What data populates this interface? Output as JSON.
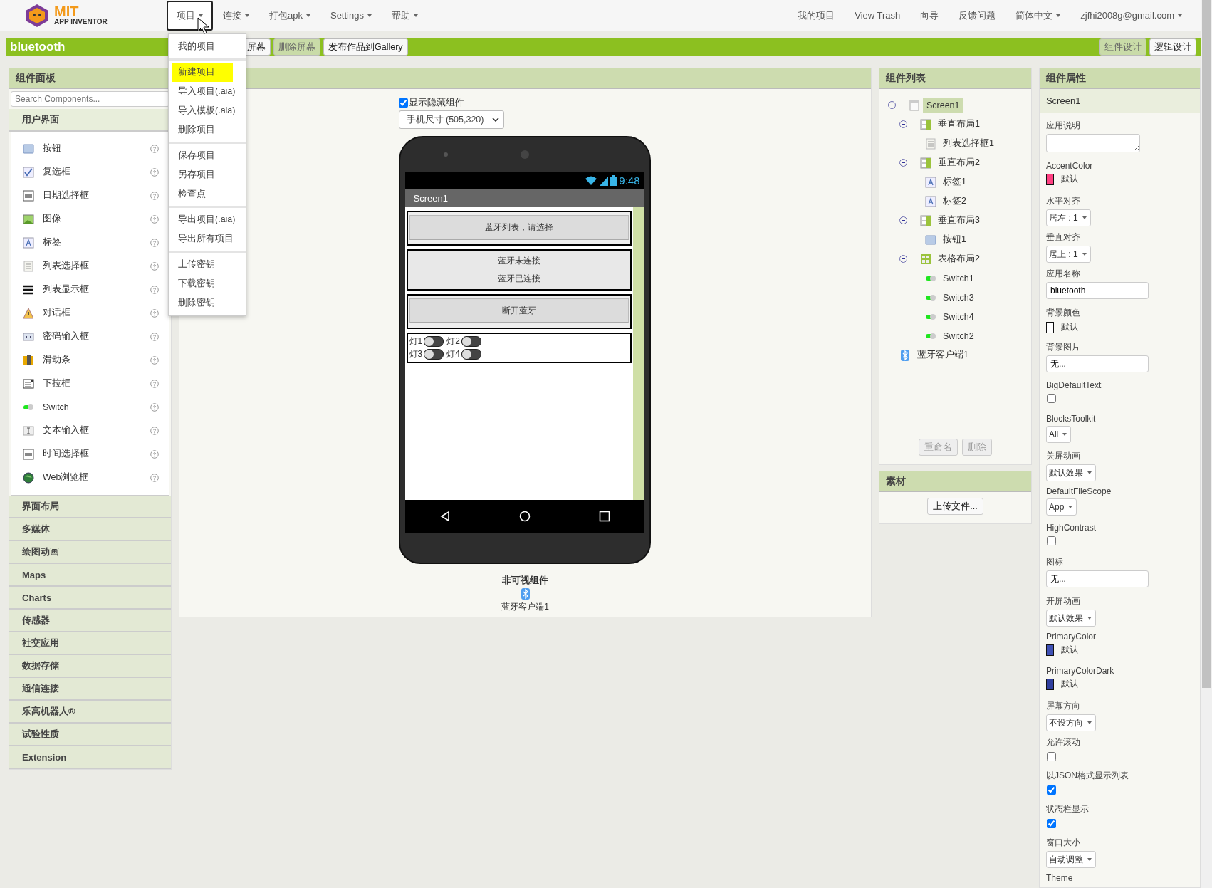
{
  "logo": {
    "title": "MIT",
    "subtitle": "APP INVENTOR"
  },
  "nav": {
    "left": [
      {
        "label": "项目",
        "selected": true
      },
      {
        "label": "连接",
        "selected": false
      },
      {
        "label": "打包apk",
        "selected": false
      },
      {
        "label": "Settings",
        "selected": false
      },
      {
        "label": "帮助",
        "selected": false
      }
    ],
    "right": [
      {
        "label": "我的项目",
        "dropdown": false
      },
      {
        "label": "View Trash",
        "dropdown": false
      },
      {
        "label": "向导",
        "dropdown": false
      },
      {
        "label": "反馈问题",
        "dropdown": false
      },
      {
        "label": "简体中文",
        "dropdown": true
      },
      {
        "label": "zjfhi2008g@gmail.com",
        "dropdown": true
      }
    ]
  },
  "project_menu": [
    [
      {
        "label": "我的项目",
        "selected": false
      }
    ],
    [
      {
        "label": "新建项目",
        "selected": true
      },
      {
        "label": "导入项目(.aia)",
        "selected": false
      },
      {
        "label": "导入模板(.aia)",
        "selected": false
      },
      {
        "label": "删除项目",
        "selected": false
      }
    ],
    [
      {
        "label": "保存项目",
        "selected": false
      },
      {
        "label": "另存项目",
        "selected": false
      },
      {
        "label": "检查点",
        "selected": false
      }
    ],
    [
      {
        "label": "导出项目(.aia)",
        "selected": false
      },
      {
        "label": "导出所有项目",
        "selected": false
      }
    ],
    [
      {
        "label": "上传密钥",
        "selected": false
      },
      {
        "label": "下载密钥",
        "selected": false
      },
      {
        "label": "删除密钥",
        "selected": false
      }
    ]
  ],
  "toolbar": {
    "project_name": "bluetooth",
    "buttons": [
      {
        "label": "屏幕",
        "disabled": false
      },
      {
        "label": "删除屏幕",
        "disabled": true
      },
      {
        "label": "发布作品到Gallery",
        "disabled": false
      }
    ],
    "views": [
      {
        "label": "组件设计",
        "selected": true
      },
      {
        "label": "逻辑设计",
        "selected": false
      }
    ]
  },
  "palette": {
    "title": "组件面板",
    "search": {
      "placeholder": "Search Components..."
    },
    "open_category": "用户界面",
    "items": [
      {
        "kind": "button",
        "label": "按钮"
      },
      {
        "kind": "checkbox",
        "label": "复选框"
      },
      {
        "kind": "datepicker",
        "label": "日期选择框"
      },
      {
        "kind": "image",
        "label": "图像"
      },
      {
        "kind": "label",
        "label": "标签"
      },
      {
        "kind": "listpicker",
        "label": "列表选择框"
      },
      {
        "kind": "listview",
        "label": "列表显示框"
      },
      {
        "kind": "notifier",
        "label": "对话框"
      },
      {
        "kind": "password",
        "label": "密码输入框"
      },
      {
        "kind": "slider",
        "label": "滑动条"
      },
      {
        "kind": "spinner",
        "label": "下拉框"
      },
      {
        "kind": "switch",
        "label": "Switch"
      },
      {
        "kind": "textbox",
        "label": "文本输入框"
      },
      {
        "kind": "timepicker",
        "label": "时间选择框"
      },
      {
        "kind": "webviewer",
        "label": "Web浏览框"
      }
    ],
    "categories": [
      "界面布局",
      "多媒体",
      "绘图动画",
      "Maps",
      "Charts",
      "传感器",
      "社交应用",
      "数据存储",
      "通信连接",
      "乐高机器人®",
      "试验性质",
      "Extension"
    ]
  },
  "viewer": {
    "show_hidden": {
      "label": "显示隐藏组件",
      "checked": true
    },
    "size": "手机尺寸 (505,320)",
    "phone": {
      "time": "9:48",
      "title": "Screen1",
      "blocks": [
        {
          "kind": "listpicker",
          "text": "蓝牙列表，请选择"
        },
        {
          "kind": "labels",
          "texts": [
            "蓝牙未连接",
            "蓝牙已连接"
          ]
        },
        {
          "kind": "button",
          "text": "断开蓝牙"
        },
        {
          "kind": "switches",
          "rows": [
            [
              {
                "label": "灯1",
                "on": false
              },
              {
                "label": "灯2",
                "on": false
              }
            ],
            [
              {
                "label": "灯3",
                "on": false
              },
              {
                "label": "灯4",
                "on": false
              }
            ]
          ]
        }
      ]
    },
    "nonvisible_title": "非可视组件",
    "nonvisible": [
      {
        "kind": "bluetooth",
        "name": "蓝牙客户端1"
      }
    ]
  },
  "tree": {
    "title": "组件列表",
    "nodes": [
      {
        "kind": "screen",
        "name": "Screen1",
        "selected": true,
        "expanded": true,
        "children": [
          {
            "kind": "vertical",
            "name": "垂直布局1",
            "selected": false,
            "expanded": true,
            "children": [
              {
                "kind": "listpicker",
                "name": "列表选择框1",
                "selected": false
              }
            ]
          },
          {
            "kind": "vertical",
            "name": "垂直布局2",
            "selected": false,
            "expanded": true,
            "children": [
              {
                "kind": "label",
                "name": "标签1",
                "selected": false
              },
              {
                "kind": "label",
                "name": "标签2",
                "selected": false
              }
            ]
          },
          {
            "kind": "vertical",
            "name": "垂直布局3",
            "selected": false,
            "expanded": true,
            "children": [
              {
                "kind": "button",
                "name": "按钮1",
                "selected": false
              }
            ]
          },
          {
            "kind": "table",
            "name": "表格布局2",
            "selected": false,
            "expanded": true,
            "children": [
              {
                "kind": "switch",
                "name": "Switch1",
                "selected": false
              },
              {
                "kind": "switch",
                "name": "Switch3",
                "selected": false
              },
              {
                "kind": "switch",
                "name": "Switch4",
                "selected": false
              },
              {
                "kind": "switch",
                "name": "Switch2",
                "selected": false
              }
            ]
          },
          {
            "kind": "bluetooth",
            "name": "蓝牙客户端1",
            "selected": false
          }
        ]
      }
    ],
    "buttons": [
      {
        "label": "重命名",
        "disabled": true
      },
      {
        "label": "删除",
        "disabled": true
      }
    ]
  },
  "media": {
    "title": "素材",
    "upload": "上传文件..."
  },
  "properties": {
    "title": "组件属性",
    "component": "Screen1",
    "items": [
      {
        "kind": "textarea",
        "label": "应用说明"
      },
      {
        "kind": "color",
        "label": "AccentColor",
        "color": "#ff4081",
        "value": "默认"
      },
      {
        "kind": "dropdown",
        "label": "水平对齐",
        "value": "居左 : 1"
      },
      {
        "kind": "dropdown",
        "label": "垂直对齐",
        "value": "居上 : 1"
      },
      {
        "kind": "text",
        "label": "应用名称",
        "value": "bluetooth"
      },
      {
        "kind": "color",
        "label": "背景颜色",
        "color": "#ffffff",
        "value": "默认"
      },
      {
        "kind": "text",
        "label": "背景图片",
        "value": "无..."
      },
      {
        "kind": "checkbox",
        "label": "BigDefaultText",
        "checked": false
      },
      {
        "kind": "dropdown",
        "label": "BlocksToolkit",
        "value": "All"
      },
      {
        "kind": "dropdown",
        "label": "关屏动画",
        "value": "默认效果"
      },
      {
        "kind": "dropdown",
        "label": "DefaultFileScope",
        "value": "App"
      },
      {
        "kind": "checkbox",
        "label": "HighContrast",
        "checked": false
      },
      {
        "kind": "text",
        "label": "图标",
        "value": "无..."
      },
      {
        "kind": "dropdown",
        "label": "开屏动画",
        "value": "默认效果"
      },
      {
        "kind": "color",
        "label": "PrimaryColor",
        "color": "#3f51b5",
        "value": "默认"
      },
      {
        "kind": "color",
        "label": "PrimaryColorDark",
        "color": "#303f9f",
        "value": "默认"
      },
      {
        "kind": "dropdown",
        "label": "屏幕方向",
        "value": "不设方向"
      },
      {
        "kind": "checkbox",
        "label": "允许滚动",
        "checked": false
      },
      {
        "kind": "checkbox",
        "label": "以JSON格式显示列表",
        "checked": true
      },
      {
        "kind": "checkbox",
        "label": "状态栏显示",
        "checked": true
      },
      {
        "kind": "dropdown",
        "label": "窗口大小",
        "value": "自动调整"
      },
      {
        "kind": "cut",
        "label": "Theme"
      }
    ]
  }
}
